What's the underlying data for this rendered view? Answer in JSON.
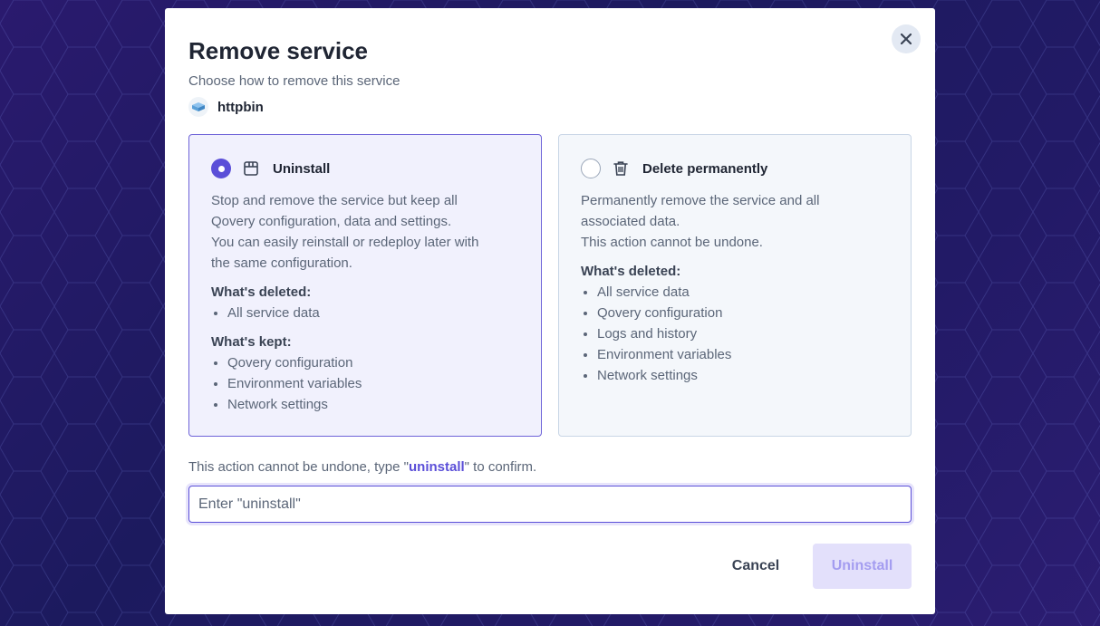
{
  "modal": {
    "title": "Remove service",
    "subtitle": "Choose how to remove this service",
    "service_name": "httpbin"
  },
  "options": [
    {
      "label": "Uninstall",
      "selected": true,
      "icon": "box-icon",
      "description": [
        "Stop and remove the service but keep all",
        "Qovery configuration, data and settings.",
        "You can easily reinstall or redeploy later with",
        "the same configuration."
      ],
      "deleted_heading": "What's deleted:",
      "deleted_items": [
        "All service data"
      ],
      "kept_heading": "What's kept:",
      "kept_items": [
        "Qovery configuration",
        "Environment variables",
        "Network settings"
      ]
    },
    {
      "label": "Delete permanently",
      "selected": false,
      "icon": "trash-icon",
      "description": [
        "Permanently remove the service and all",
        "associated data.",
        "This action cannot be undone."
      ],
      "deleted_heading": "What's deleted:",
      "deleted_items": [
        "All service data",
        "Qovery configuration",
        "Logs and history",
        "Environment variables",
        "Network settings"
      ]
    }
  ],
  "confirm": {
    "prefix": "This action cannot be undone, type \"",
    "keyword": "uninstall",
    "suffix": "\" to confirm.",
    "placeholder": "Enter \"uninstall\"",
    "value": ""
  },
  "actions": {
    "cancel_label": "Cancel",
    "submit_label": "Uninstall"
  },
  "colors": {
    "accent": "#5b4fd8",
    "disabled_button_bg": "#e3e0fb",
    "disabled_button_text": "#a49df0"
  }
}
